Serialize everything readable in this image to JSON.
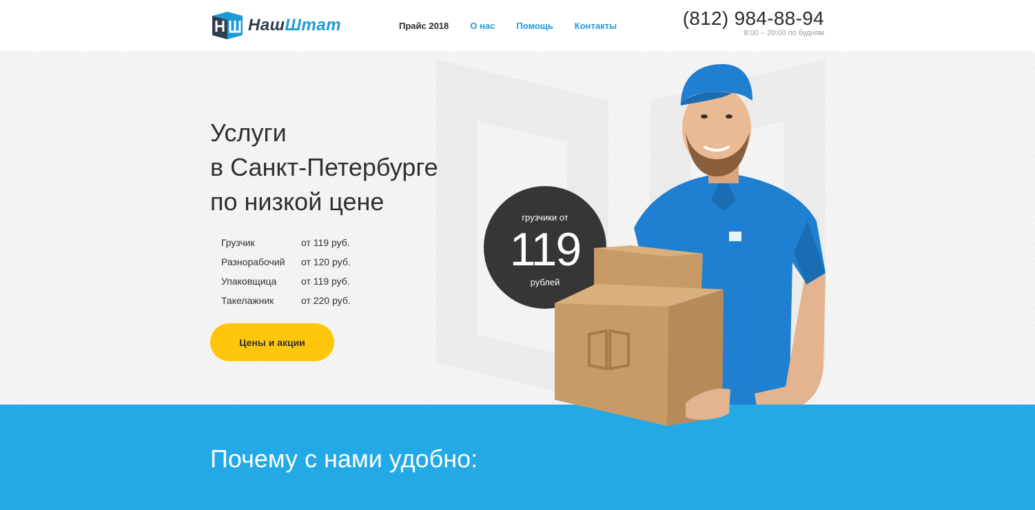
{
  "header": {
    "logo": {
      "text_part1": "Наш",
      "text_part2": "Штат",
      "mark": "nashshtat-logo-icon"
    },
    "nav": [
      {
        "label": "Прайс 2018",
        "active": true
      },
      {
        "label": "О нас",
        "active": false
      },
      {
        "label": "Помощь",
        "active": false
      },
      {
        "label": "Контакты",
        "active": false
      }
    ],
    "phone": {
      "number": "(812) 984-88-94",
      "hours": "8:00 – 20:00 по будням"
    }
  },
  "hero": {
    "title_lines": [
      "Услуги",
      "в Санкт-Петербурге",
      "по низкой цене"
    ],
    "prices": [
      {
        "name": "Грузчик",
        "value": "от 119 руб."
      },
      {
        "name": "Разнорабочий",
        "value": "от 120 руб."
      },
      {
        "name": "Упаковщица",
        "value": "от 119 руб."
      },
      {
        "name": "Такелажник",
        "value": "от 220 руб."
      }
    ],
    "cta_label": "Цены и акции",
    "badge": {
      "top": "грузчики от",
      "number": "119",
      "bottom": "рублей"
    }
  },
  "why": {
    "title": "Почему с нами удобно:"
  },
  "colors": {
    "accent_blue": "#23a9e6",
    "link_blue": "#1e9bd7",
    "button_yellow": "#ffc70b",
    "badge_dark": "#363636",
    "uniform_blue": "#1f7fd0",
    "cardboard": "#c89b66"
  }
}
